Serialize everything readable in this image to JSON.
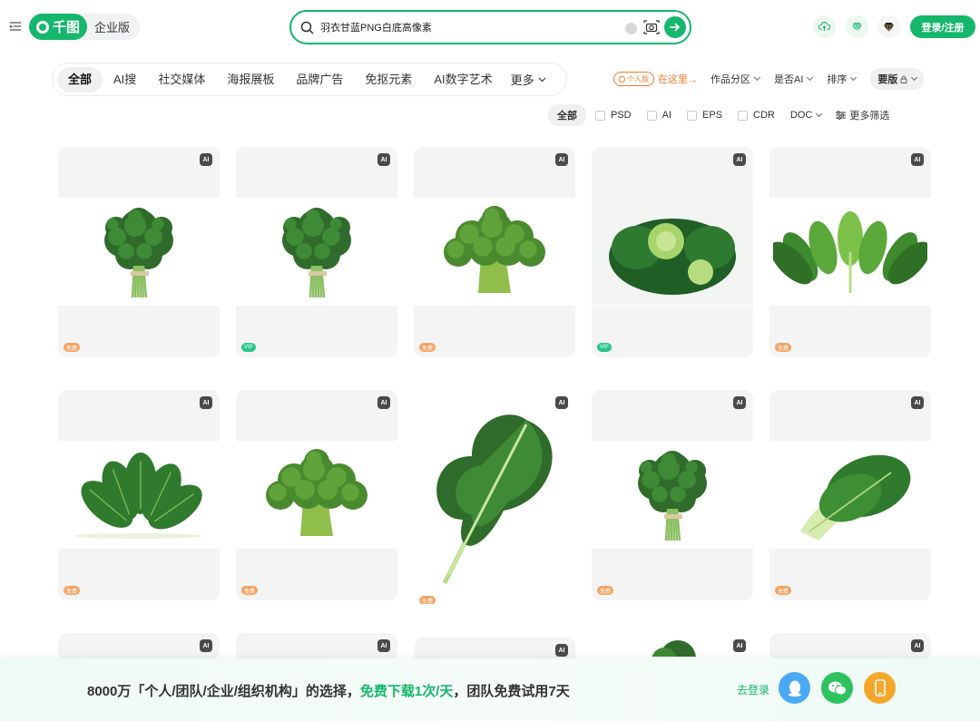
{
  "header": {
    "logo_text": "千图",
    "edition_label": "企业版",
    "search": {
      "value": "羽衣甘蓝PNG白底高像素",
      "placeholder": ""
    },
    "login_label": "登录/注册"
  },
  "categories": {
    "items": [
      "全部",
      "AI搜",
      "社交媒体",
      "海报展板",
      "品牌广告",
      "免抠元素",
      "AI数字艺术"
    ],
    "more_label": "更多"
  },
  "right_filters": {
    "personal_badge": "个人版",
    "here_link": "在这里→",
    "dropdowns": [
      "作品分区",
      "是否AI",
      "排序"
    ],
    "license": "要版"
  },
  "format_filters": {
    "all_label": "全部",
    "formats": [
      "PSD",
      "AI",
      "EPS",
      "CDR"
    ],
    "doc_label": "DOC",
    "more_label": "更多筛选"
  },
  "cards": [
    {
      "subject": "kale-bunch",
      "ai_badge": "AI",
      "tag": "免费",
      "tag_type": "free"
    },
    {
      "subject": "kale-bunch",
      "ai_badge": "AI",
      "tag": "VIP",
      "tag_type": "vip"
    },
    {
      "subject": "broccoli",
      "ai_badge": "AI",
      "tag": "免费",
      "tag_type": "free"
    },
    {
      "subject": "cabbage",
      "ai_badge": "AI",
      "tag": "VIP",
      "tag_type": "vip"
    },
    {
      "subject": "spinach",
      "ai_badge": "AI",
      "tag": "免费",
      "tag_type": "free"
    },
    {
      "subject": "spinach-leaves",
      "ai_badge": "AI",
      "tag": "免费",
      "tag_type": "free"
    },
    {
      "subject": "broccoli",
      "ai_badge": "AI",
      "tag": "免费",
      "tag_type": "free"
    },
    {
      "subject": "kale-leaf",
      "ai_badge": "AI",
      "tag": "免费",
      "tag_type": "free"
    },
    {
      "subject": "kale-bunch",
      "ai_badge": "AI",
      "tag": "免费",
      "tag_type": "free"
    },
    {
      "subject": "bok-choy",
      "ai_badge": "AI",
      "tag": "免费",
      "tag_type": "free"
    },
    {
      "subject": "partial",
      "ai_badge": "AI",
      "tag": "",
      "tag_type": ""
    },
    {
      "subject": "partial",
      "ai_badge": "AI",
      "tag": "",
      "tag_type": ""
    },
    {
      "subject": "partial",
      "ai_badge": "AI",
      "tag": "",
      "tag_type": ""
    },
    {
      "subject": "partial",
      "ai_badge": "AI",
      "tag": "",
      "tag_type": ""
    },
    {
      "subject": "partial",
      "ai_badge": "AI",
      "tag": "",
      "tag_type": ""
    }
  ],
  "banner": {
    "text_prefix": "8000万「个人/团队/企业/组织机构」的选择，",
    "highlight": "免费下载1次/天",
    "text_suffix": "，团队免费试用7天",
    "login_link": "去登录"
  },
  "colors": {
    "brand_green": "#14b76b",
    "orange_accent": "#f07c2e",
    "free_tag": "#f6a363",
    "vip_tag": "#2bc48a",
    "qq_blue": "#4aa9f5",
    "wechat_green": "#2dc460",
    "phone_orange": "#f4a72a"
  }
}
